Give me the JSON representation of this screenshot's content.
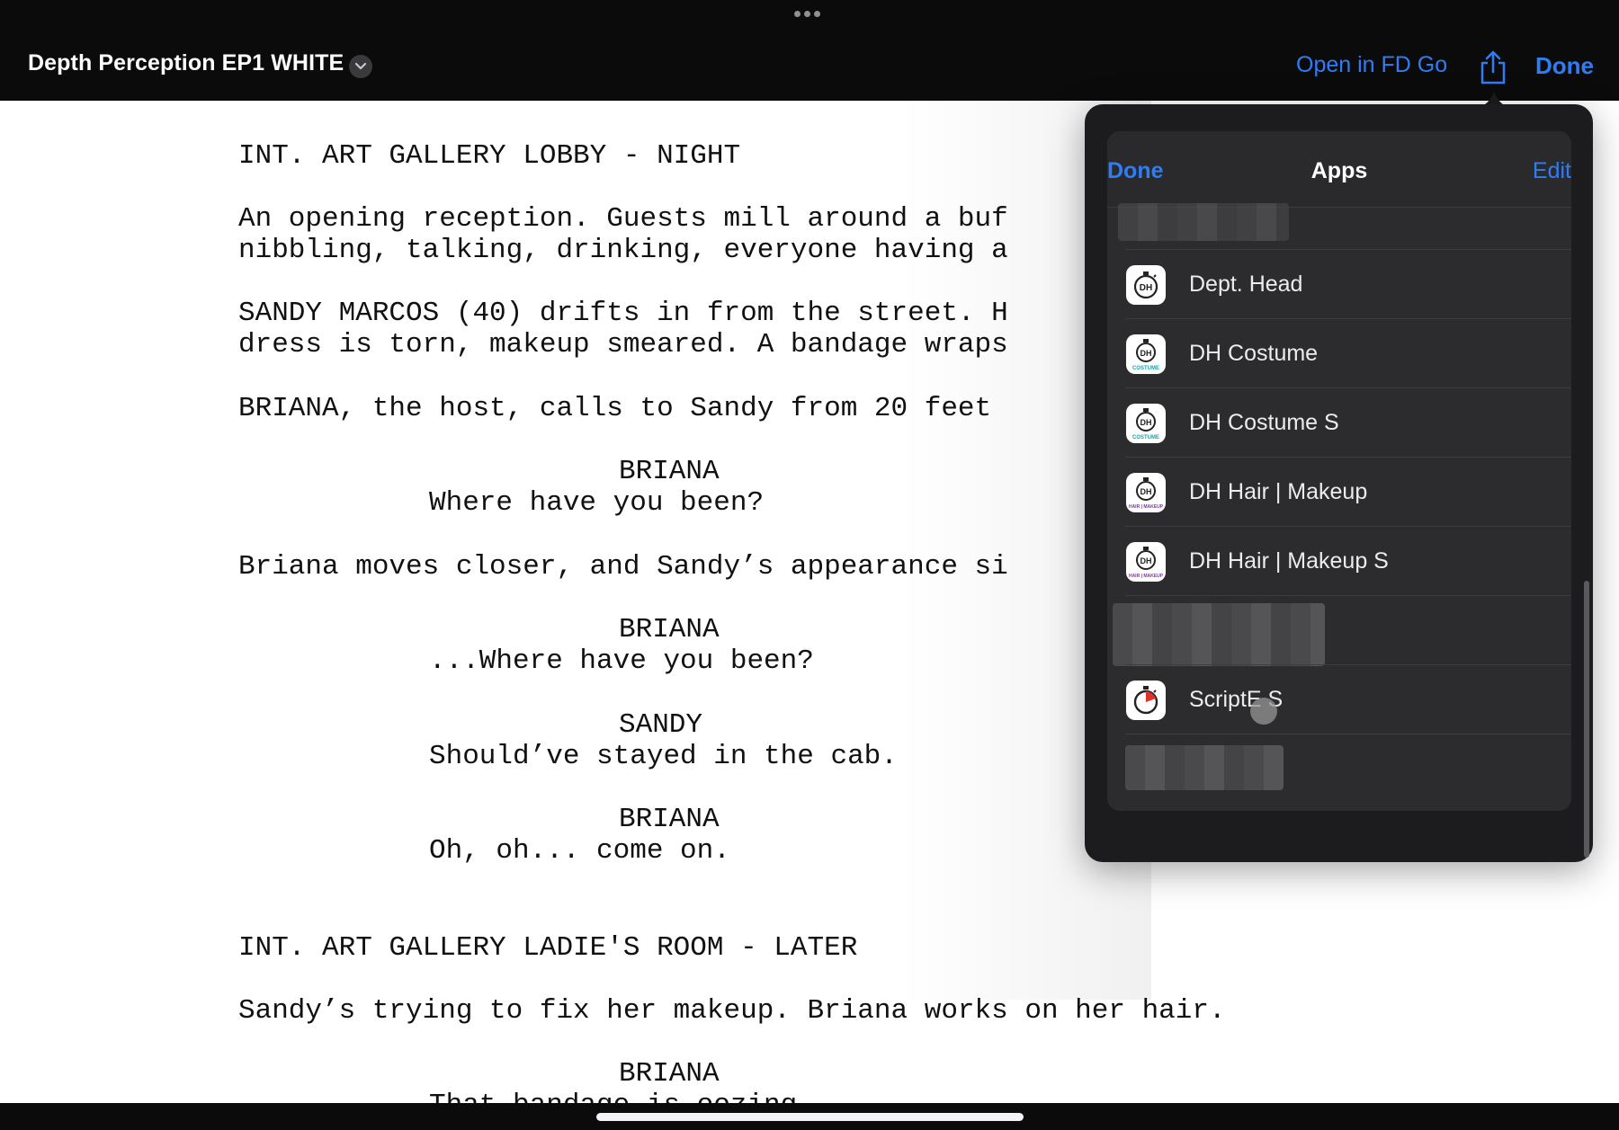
{
  "topbar": {
    "doc_title": "Depth Perception EP1 WHITE",
    "open_in_fd_go": "Open in FD Go",
    "done": "Done",
    "icons": [
      "more-dots-icon",
      "chevron-down-icon",
      "share-icon"
    ]
  },
  "script": {
    "lines": [
      "INT. ART GALLERY LOBBY - NIGHT",
      "An opening reception. Guests mill around a buf",
      "nibbling, talking, drinking, everyone having a",
      "SANDY MARCOS (40) drifts in from the street. H",
      "dress is torn, makeup smeared. A bandage wraps",
      "BRIANA, the host, calls to Sandy from 20 feet",
      "BRIANA",
      "Where have you been?",
      "Briana moves closer, and Sandy’s appearance si",
      "BRIANA",
      "...Where have you been?",
      "SANDY",
      "Should’ve stayed in the cab.",
      "BRIANA",
      "Oh, oh... come on.",
      "INT. ART GALLERY LADIE'S ROOM - LATER",
      "Sandy’s trying to fix her makeup. Briana works on her hair.",
      "BRIANA",
      "That bandage is oozing."
    ]
  },
  "apps_sheet": {
    "done": "Done",
    "title": "Apps",
    "edit": "Edit",
    "items": [
      {
        "label": "Dept. Head",
        "icon": "dh-app-icon"
      },
      {
        "label": "DH Costume",
        "icon": "dh-costume-icon"
      },
      {
        "label": "DH Costume S",
        "icon": "dh-costume-icon"
      },
      {
        "label": "DH Hair | Makeup",
        "icon": "dh-hair-makeup-icon"
      },
      {
        "label": "DH Hair | Makeup S",
        "icon": "dh-hair-makeup-icon"
      },
      {
        "label": "ScriptE S",
        "icon": "scripte-stopwatch-icon"
      }
    ],
    "icon_sub_labels": {
      "costume": "COSTUME",
      "hair_makeup": "HAIR | MAKEUP",
      "dh": "DH"
    }
  },
  "colors": {
    "accent": "#2f7df6",
    "bar": "#0b0b0c",
    "sheet": "#2c2c2e",
    "costume_teal": "#1aa3a3",
    "makeup_purple": "#7a3aa0",
    "scripte_red": "#e0302a"
  }
}
